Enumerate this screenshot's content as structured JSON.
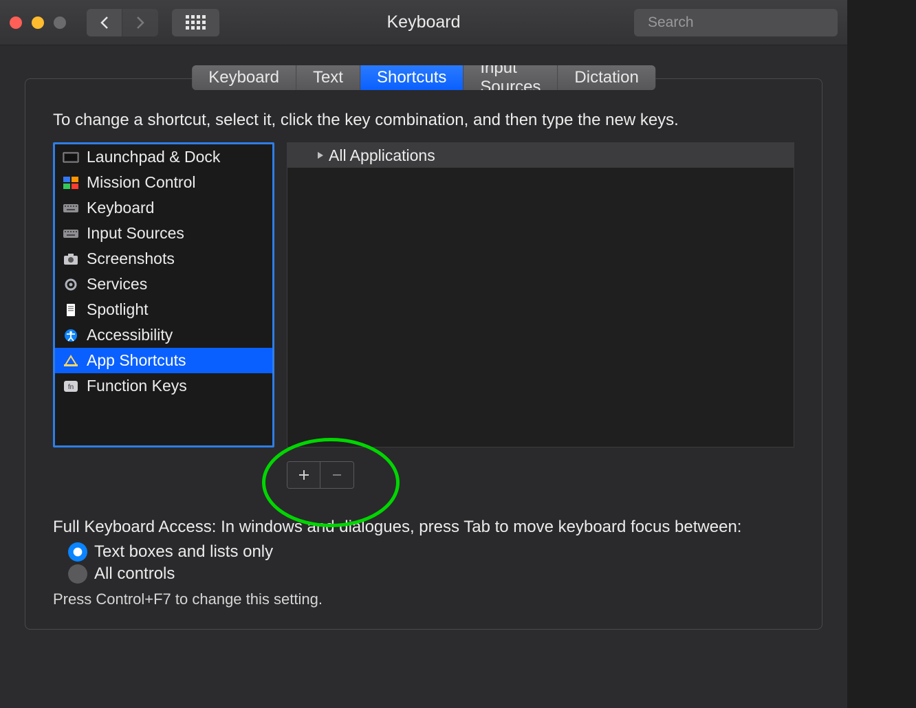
{
  "window": {
    "title": "Keyboard"
  },
  "search": {
    "placeholder": "Search",
    "value": ""
  },
  "tabs": [
    {
      "label": "Keyboard",
      "active": false
    },
    {
      "label": "Text",
      "active": false
    },
    {
      "label": "Shortcuts",
      "active": true
    },
    {
      "label": "Input Sources",
      "active": false
    },
    {
      "label": "Dictation",
      "active": false
    }
  ],
  "instructions": "To change a shortcut, select it, click the key combination, and then type the new keys.",
  "categories": [
    {
      "id": "launchpad-dock",
      "label": "Launchpad & Dock",
      "icon": "launchpad-icon"
    },
    {
      "id": "mission-control",
      "label": "Mission Control",
      "icon": "mission-control-icon"
    },
    {
      "id": "keyboard",
      "label": "Keyboard",
      "icon": "keyboard-icon"
    },
    {
      "id": "input-sources",
      "label": "Input Sources",
      "icon": "keyboard-icon"
    },
    {
      "id": "screenshots",
      "label": "Screenshots",
      "icon": "camera-icon"
    },
    {
      "id": "services",
      "label": "Services",
      "icon": "gear-icon"
    },
    {
      "id": "spotlight",
      "label": "Spotlight",
      "icon": "document-icon"
    },
    {
      "id": "accessibility",
      "label": "Accessibility",
      "icon": "accessibility-icon"
    },
    {
      "id": "app-shortcuts",
      "label": "App Shortcuts",
      "icon": "app-store-icon",
      "selected": true
    },
    {
      "id": "function-keys",
      "label": "Function Keys",
      "icon": "fn-icon"
    }
  ],
  "detail": {
    "header": "All Applications"
  },
  "buttons": {
    "add_enabled": true,
    "remove_enabled": false
  },
  "keyboard_access": {
    "heading": "Full Keyboard Access: In windows and dialogues, press Tab to move keyboard focus between:",
    "options": [
      {
        "label": "Text boxes and lists only",
        "checked": true
      },
      {
        "label": "All controls",
        "checked": false
      }
    ],
    "hint": "Press Control+F7 to change this setting."
  },
  "annotation": {
    "highlight_color": "#00d600"
  }
}
